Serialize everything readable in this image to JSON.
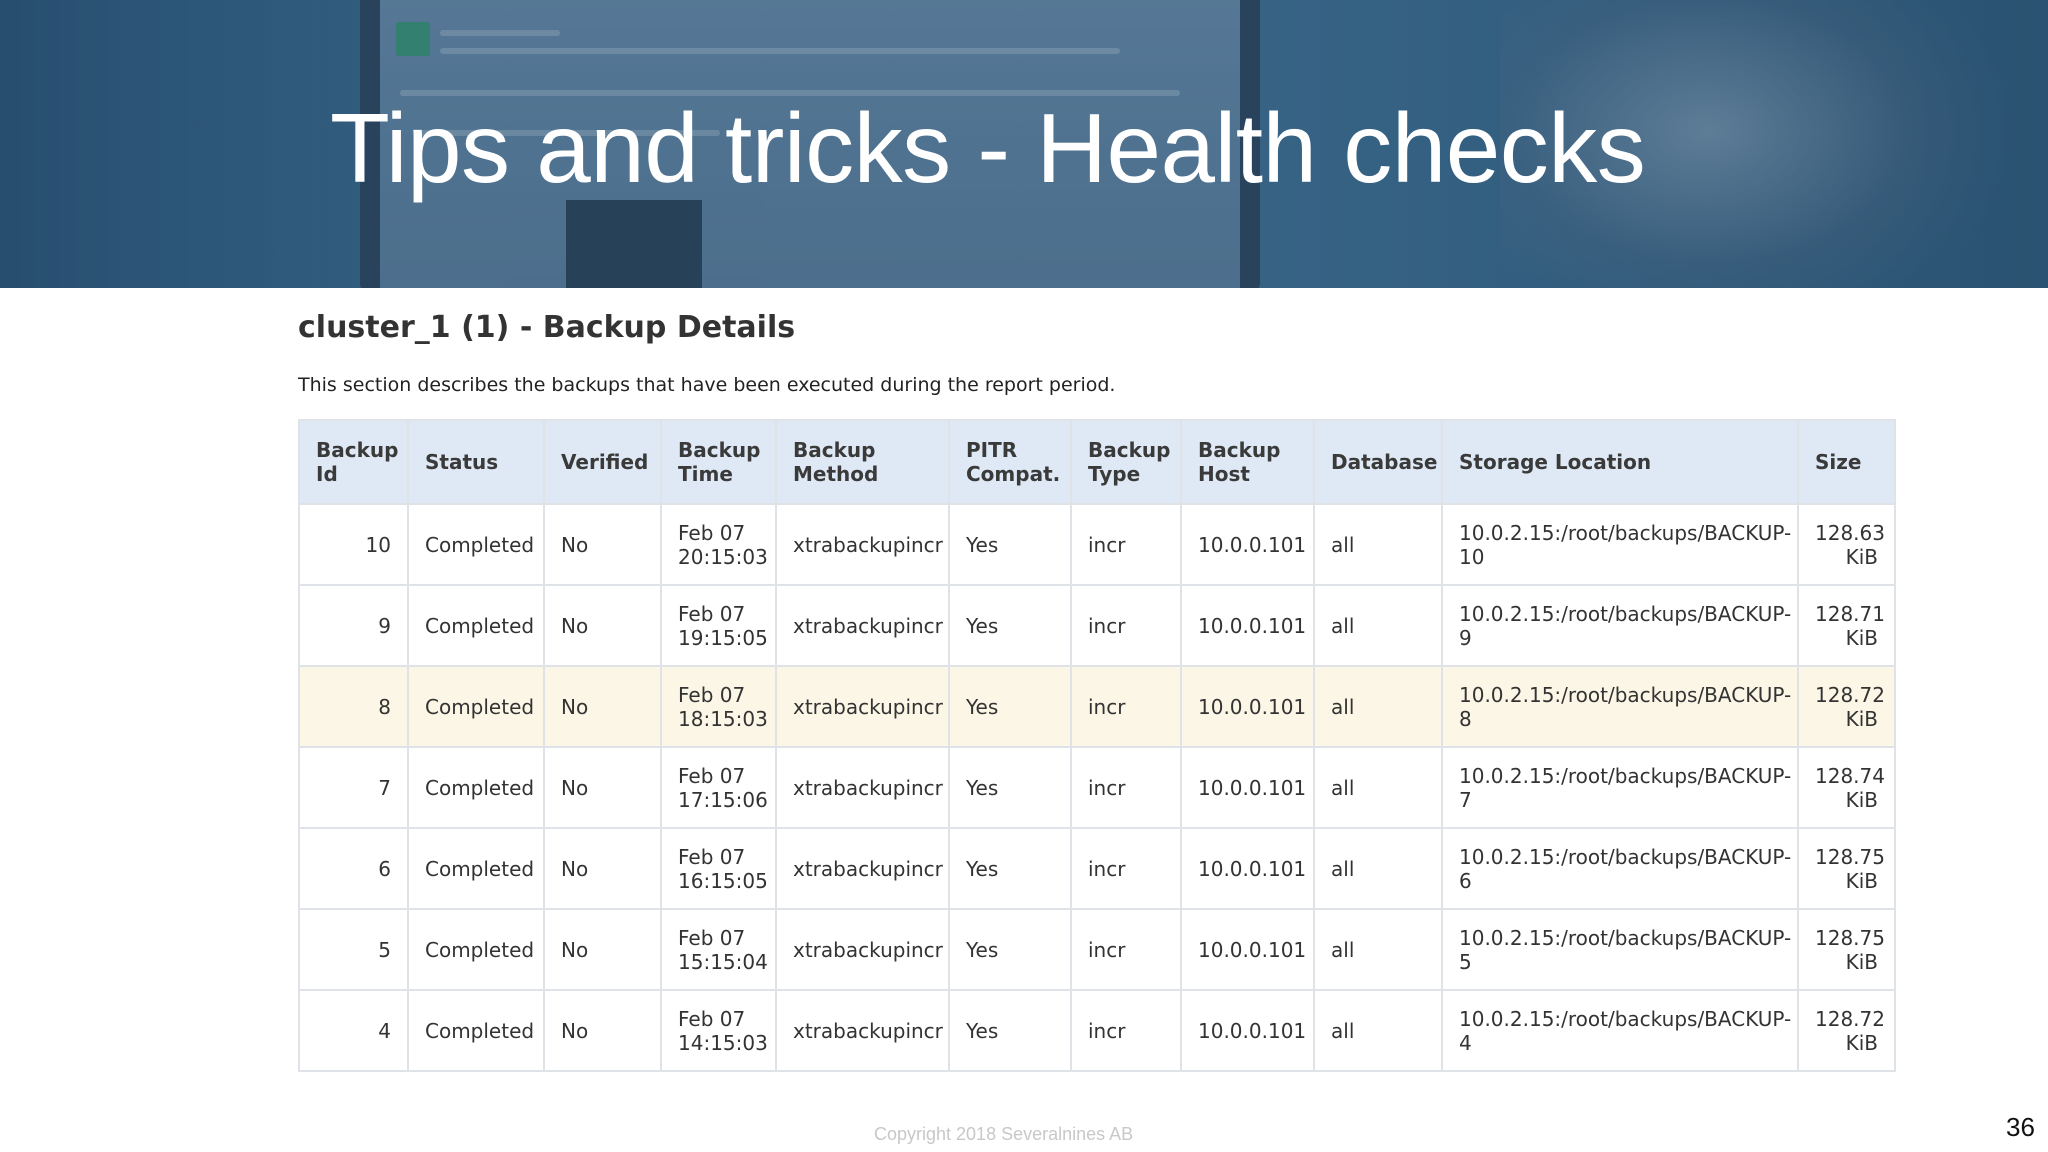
{
  "slide": {
    "title": "Tips and tricks - Health checks",
    "copyright": "Copyright 2018 Severalnines AB",
    "page_number": "36"
  },
  "section": {
    "title": "cluster_1 (1) - Backup Details",
    "description": "This section describes the backups that have been executed during the report period."
  },
  "table": {
    "headers": [
      [
        "Backup",
        "Id"
      ],
      [
        "Status"
      ],
      [
        "Verified"
      ],
      [
        "Backup",
        "Time"
      ],
      [
        "Backup",
        "Method"
      ],
      [
        "PITR",
        "Compat."
      ],
      [
        "Backup",
        "Type"
      ],
      [
        "Backup",
        "Host"
      ],
      [
        "Database"
      ],
      [
        "Storage Location"
      ],
      [
        "Size"
      ]
    ],
    "rows": [
      {
        "id": "10",
        "status": "Completed",
        "verified": "No",
        "date": "Feb 07",
        "time": "20:15:03",
        "method": "xtrabackupincr",
        "pitr": "Yes",
        "type": "incr",
        "host": "10.0.0.101",
        "database": "all",
        "loc1": "10.0.2.15:/root/backups/BACKUP-",
        "loc2": "10",
        "size1": "128.63",
        "size2": "KiB",
        "highlight": false
      },
      {
        "id": "9",
        "status": "Completed",
        "verified": "No",
        "date": "Feb 07",
        "time": "19:15:05",
        "method": "xtrabackupincr",
        "pitr": "Yes",
        "type": "incr",
        "host": "10.0.0.101",
        "database": "all",
        "loc1": "10.0.2.15:/root/backups/BACKUP-",
        "loc2": "9",
        "size1": "128.71",
        "size2": "KiB",
        "highlight": false
      },
      {
        "id": "8",
        "status": "Completed",
        "verified": "No",
        "date": "Feb 07",
        "time": "18:15:03",
        "method": "xtrabackupincr",
        "pitr": "Yes",
        "type": "incr",
        "host": "10.0.0.101",
        "database": "all",
        "loc1": "10.0.2.15:/root/backups/BACKUP-",
        "loc2": "8",
        "size1": "128.72",
        "size2": "KiB",
        "highlight": true
      },
      {
        "id": "7",
        "status": "Completed",
        "verified": "No",
        "date": "Feb 07",
        "time": "17:15:06",
        "method": "xtrabackupincr",
        "pitr": "Yes",
        "type": "incr",
        "host": "10.0.0.101",
        "database": "all",
        "loc1": "10.0.2.15:/root/backups/BACKUP-",
        "loc2": "7",
        "size1": "128.74",
        "size2": "KiB",
        "highlight": false
      },
      {
        "id": "6",
        "status": "Completed",
        "verified": "No",
        "date": "Feb 07",
        "time": "16:15:05",
        "method": "xtrabackupincr",
        "pitr": "Yes",
        "type": "incr",
        "host": "10.0.0.101",
        "database": "all",
        "loc1": "10.0.2.15:/root/backups/BACKUP-",
        "loc2": "6",
        "size1": "128.75",
        "size2": "KiB",
        "highlight": false
      },
      {
        "id": "5",
        "status": "Completed",
        "verified": "No",
        "date": "Feb 07",
        "time": "15:15:04",
        "method": "xtrabackupincr",
        "pitr": "Yes",
        "type": "incr",
        "host": "10.0.0.101",
        "database": "all",
        "loc1": "10.0.2.15:/root/backups/BACKUP-",
        "loc2": "5",
        "size1": "128.75",
        "size2": "KiB",
        "highlight": false
      },
      {
        "id": "4",
        "status": "Completed",
        "verified": "No",
        "date": "Feb 07",
        "time": "14:15:03",
        "method": "xtrabackupincr",
        "pitr": "Yes",
        "type": "incr",
        "host": "10.0.0.101",
        "database": "all",
        "loc1": "10.0.2.15:/root/backups/BACKUP-",
        "loc2": "4",
        "size1": "128.72",
        "size2": "KiB",
        "highlight": false
      }
    ]
  },
  "colors": {
    "header_bg": "#dfe9f5",
    "highlight_row_bg": "#fbf6e6",
    "border": "#dfe3e7",
    "banner_overlay": "#28557d"
  }
}
